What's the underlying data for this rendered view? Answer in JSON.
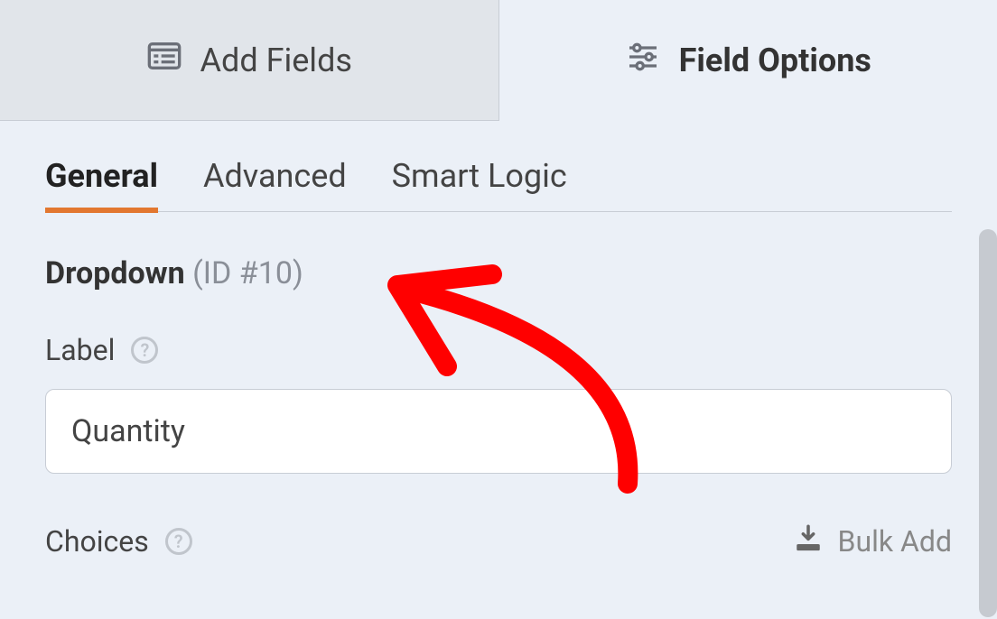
{
  "top_tabs": {
    "add_fields": "Add Fields",
    "field_options": "Field Options"
  },
  "sub_tabs": {
    "general": "General",
    "advanced": "Advanced",
    "smart_logic": "Smart Logic"
  },
  "field": {
    "type_label": "Dropdown",
    "id_label": "(ID #10)"
  },
  "label_section": {
    "title": "Label",
    "value": "Quantity"
  },
  "choices_section": {
    "title": "Choices",
    "bulk_add_label": "Bulk Add"
  }
}
